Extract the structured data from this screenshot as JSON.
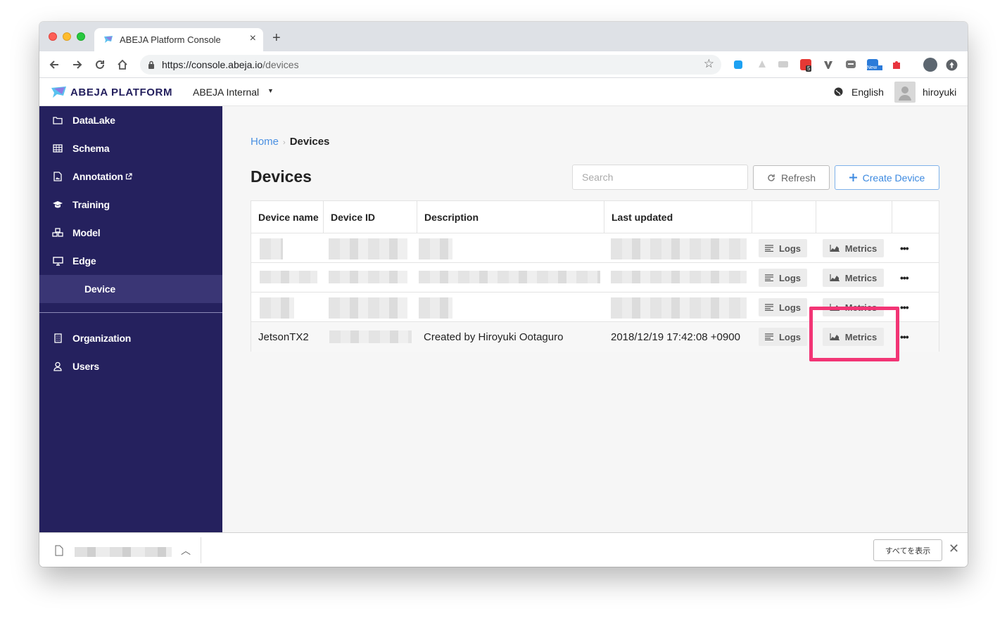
{
  "browser": {
    "tab_title": "ABEJA Platform Console",
    "url_host": "https://console.abeja.io",
    "url_path": "/devices",
    "extensions": [
      "bl-icon",
      "tree-icon",
      "chat-icon",
      "badge-icon",
      "vimium-icon",
      "message-icon",
      "new-icon",
      "puzzle-icon"
    ],
    "ext_badge": "5",
    "ext_new": "New"
  },
  "header": {
    "logo_text": "ABEJA PLATFORM",
    "org_name": "ABEJA Internal",
    "language": "English",
    "username": "hiroyuki"
  },
  "sidebar": {
    "items": [
      {
        "label": "DataLake",
        "icon": "folder-icon"
      },
      {
        "label": "Schema",
        "icon": "table-icon"
      },
      {
        "label": "Annotation",
        "icon": "image-icon"
      },
      {
        "label": "Training",
        "icon": "graduation-cap-icon"
      },
      {
        "label": "Model",
        "icon": "cubes-icon"
      },
      {
        "label": "Edge",
        "icon": "desktop-icon"
      },
      {
        "label": "Device",
        "icon": ""
      },
      {
        "label": "Organization",
        "icon": "building-icon"
      },
      {
        "label": "Users",
        "icon": "user-icon"
      }
    ],
    "active": "Device"
  },
  "breadcrumb": {
    "home": "Home",
    "separator": "›",
    "current": "Devices"
  },
  "page": {
    "title": "Devices",
    "search_placeholder": "Search",
    "refresh_label": "Refresh",
    "create_label": "Create Device"
  },
  "table": {
    "columns": [
      "Device name",
      "Device ID",
      "Description",
      "Last updated"
    ],
    "logs_label": "Logs",
    "metrics_label": "Metrics",
    "more_label": "•••",
    "last_row": {
      "device_name": "JetsonTX2",
      "description": "Created by Hiroyuki Ootaguro",
      "last_updated": "2018/12/19 17:42:08 +0900"
    }
  },
  "download_bar": {
    "show_all": "すべてを表示"
  },
  "colors": {
    "sidebar_bg": "#25215e",
    "sidebar_active": "#3a3675",
    "link_blue": "#4a90e2",
    "highlight": "#f23575"
  }
}
